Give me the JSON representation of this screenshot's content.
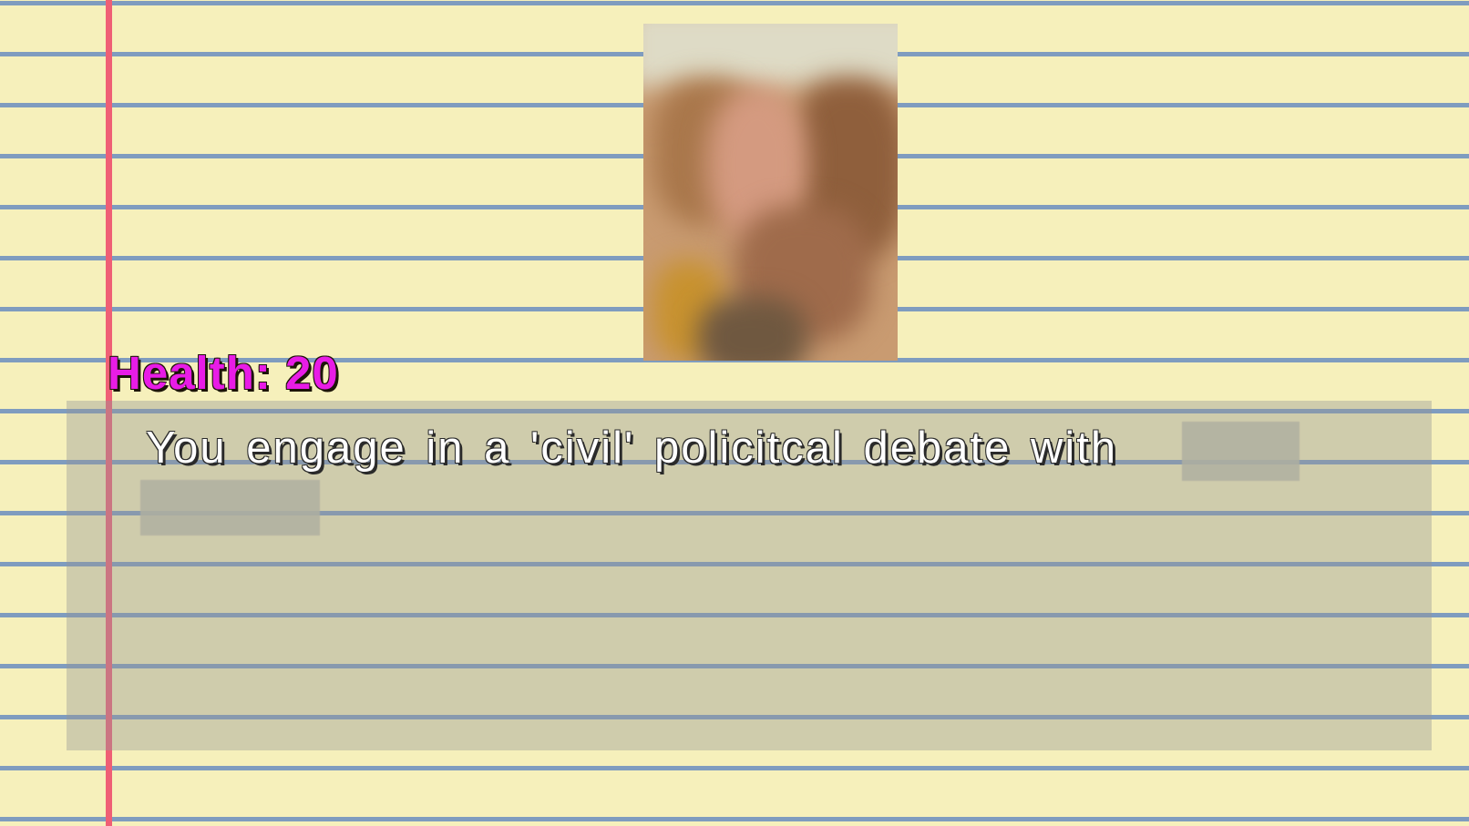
{
  "hud": {
    "health_text": "Health: 20",
    "health_value": 20
  },
  "dialog": {
    "message": "You engage in a 'civil' policitcal debate with"
  },
  "colors": {
    "paper": "#f6f0bb",
    "rule_lines": "#7f9cbf",
    "margin_line": "#ef5f75",
    "health_text": "#e81ce6",
    "dialog_text": "#ffffff"
  }
}
